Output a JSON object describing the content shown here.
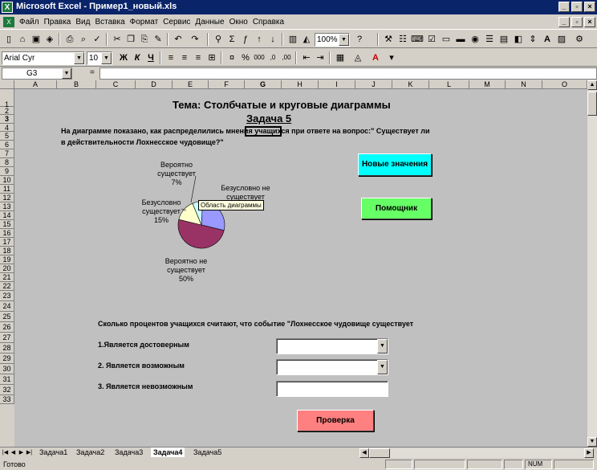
{
  "window": {
    "title": "Microsoft Excel - Пример1_новый.xls"
  },
  "menu": {
    "items": [
      "Файл",
      "Правка",
      "Вид",
      "Вставка",
      "Формат",
      "Сервис",
      "Данные",
      "Окно",
      "Справка"
    ]
  },
  "toolbar": {
    "font_name": "Arial Cyr",
    "font_size": "10",
    "zoom": "100%"
  },
  "formula_bar": {
    "name_box": "G3",
    "equals": "="
  },
  "columns": [
    "A",
    "B",
    "C",
    "D",
    "E",
    "F",
    "G",
    "H",
    "I",
    "J",
    "K",
    "L",
    "M",
    "N",
    "O"
  ],
  "selected_column": "G",
  "rows": [
    "1",
    "2",
    "3",
    "4",
    "5",
    "6",
    "7",
    "8",
    "9",
    "10",
    "11",
    "12",
    "13",
    "14",
    "15",
    "16",
    "17",
    "18",
    "19",
    "20",
    "21",
    "22",
    "23",
    "24",
    "25",
    "26",
    "27",
    "28",
    "29",
    "30",
    "31",
    "32",
    "33"
  ],
  "selected_row": "3",
  "sheet": {
    "title": "Тема: Столбчатые и круговые диаграммы",
    "subtitle": "Задача 5",
    "question_line1": "На диаграмме показано, как распределились мнения учащихся при ответе на вопрос:\" Существует ли",
    "question_line2": "в действительности Лохнесское чудовище?\"",
    "task_question": "Сколько процентов учащихся считают, что событие \"Лохнесское чудовище существует",
    "item1": "1.Является достоверным",
    "item2": "2. Является возможным",
    "item3": "3. Является невозможным",
    "btn_new": "Новые значения",
    "btn_help": "Помощник",
    "btn_check": "Проверка"
  },
  "chart_data": {
    "type": "pie",
    "tooltip": "Область диаграммы",
    "slices": [
      {
        "name_line1": "Безусловно не",
        "name_line2": "существует",
        "value": 28,
        "color": "#9999ff"
      },
      {
        "name_line1": "Вероятно не",
        "name_line2": "существует",
        "value": 50,
        "label": "50%",
        "color": "#993366"
      },
      {
        "name_line1": "Безусловно",
        "name_line2": "существует",
        "value": 15,
        "label": "15%",
        "color": "#ffffcc"
      },
      {
        "name_line1": "Вероятно",
        "name_line2": "существует",
        "value": 7,
        "label": "7%",
        "color": "#ccffff"
      }
    ]
  },
  "tabs": {
    "items": [
      "Задача1",
      "Задача2",
      "Задача3",
      "Задача4",
      "Задача5"
    ],
    "active": "Задача4"
  },
  "status": {
    "text": "Готово",
    "num": "NUM"
  }
}
